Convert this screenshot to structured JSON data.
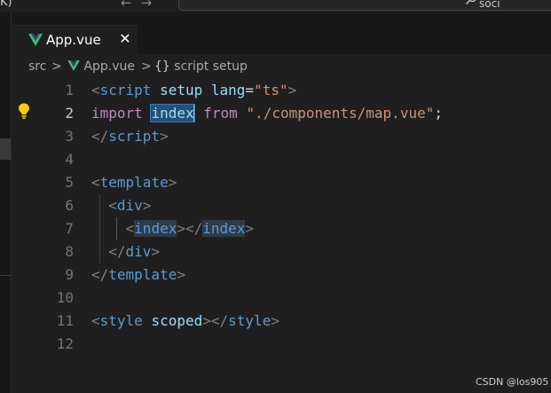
{
  "titlebar": {
    "left_text": "K)",
    "nav_ellipsis": "···",
    "back_arrow": "←",
    "forward_arrow": "→",
    "search_text": "soci"
  },
  "tab": {
    "label": "App.vue",
    "close": "✕",
    "icon": "vue-icon"
  },
  "breadcrumb": {
    "folder": "src",
    "file": "App.vue",
    "symbol_icon": "{}",
    "symbol": "script setup",
    "separator": ">"
  },
  "editor": {
    "active_line": 2,
    "line_numbers": [
      "1",
      "2",
      "3",
      "4",
      "5",
      "6",
      "7",
      "8",
      "9",
      "10",
      "11",
      "12"
    ],
    "line1": {
      "open": "<",
      "tag": "script",
      "attr1": "setup",
      "attr2": "lang",
      "eq": "=",
      "value": "\"ts\"",
      "close": ">"
    },
    "line2": {
      "keyword": "import",
      "ident": "index",
      "from": "from",
      "path": "\"./components/map.vue\"",
      "semi": ";"
    },
    "line3": {
      "open": "</",
      "tag": "script",
      "close": ">"
    },
    "line5": {
      "open": "<",
      "tag": "template",
      "close": ">"
    },
    "line6": {
      "open": "<",
      "tag": "div",
      "close": ">"
    },
    "line7": {
      "open1": "<",
      "tag1": "index",
      "mid": "></",
      "tag2": "index",
      "close": ">"
    },
    "line8": {
      "open": "</",
      "tag": "div",
      "close": ">"
    },
    "line9": {
      "open": "</",
      "tag": "template",
      "close": ">"
    },
    "line11": {
      "open1": "<",
      "tag1": "style",
      "attr": "scoped",
      "mid": "></",
      "tag2": "style",
      "close": ">"
    }
  },
  "watermark": "CSDN @los905",
  "colors": {
    "background": "#1f1f1f",
    "tag": "#569cd6",
    "attribute": "#9cdcfe",
    "string": "#ce9178",
    "keyword": "#c586c0",
    "selection": "#264f78",
    "vue_green": "#41b883"
  }
}
